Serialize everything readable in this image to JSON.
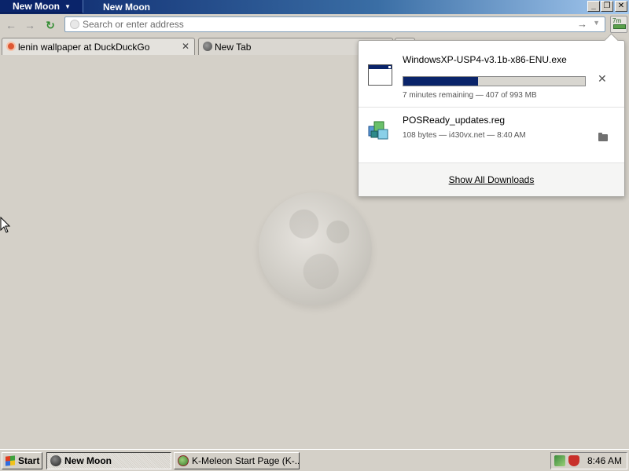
{
  "titlebar": {
    "app_menu_label": "New Moon",
    "window_title": "New Moon",
    "minimize": "_",
    "restore": "❐",
    "close": "✕"
  },
  "nav": {
    "back": "←",
    "forward": "→",
    "reload": "↻",
    "url_placeholder": "Search or enter address",
    "url_value": "",
    "go": "→",
    "dropdown": "▼"
  },
  "tabs": [
    {
      "label": "lenin wallpaper at DuckDuckGo",
      "close": "✕",
      "icon": "duckduckgo-icon"
    },
    {
      "label": "New Tab",
      "close": "✕",
      "icon": "globe-icon"
    }
  ],
  "new_tab": "+",
  "downloads": {
    "items": [
      {
        "name": "WindowsXP-USP4-v3.1b-x86-ENU.exe",
        "meta": "7 minutes remaining — 407 of 993 MB",
        "progress": 0.41,
        "action": "✕"
      },
      {
        "name": "POSReady_updates.reg",
        "meta": "108 bytes — i430vx.net — 8:40 AM"
      }
    ],
    "show_all": "Show All Downloads"
  },
  "taskbar": {
    "start": "Start",
    "tasks": [
      {
        "label": "New Moon"
      },
      {
        "label": "K-Meleon Start Page (K-..."
      }
    ],
    "clock": "8:46 AM"
  },
  "colors": {
    "title_bar": "#0a246a",
    "progress_fill": "#0a246a",
    "window_bg": "#d4d0c8"
  }
}
